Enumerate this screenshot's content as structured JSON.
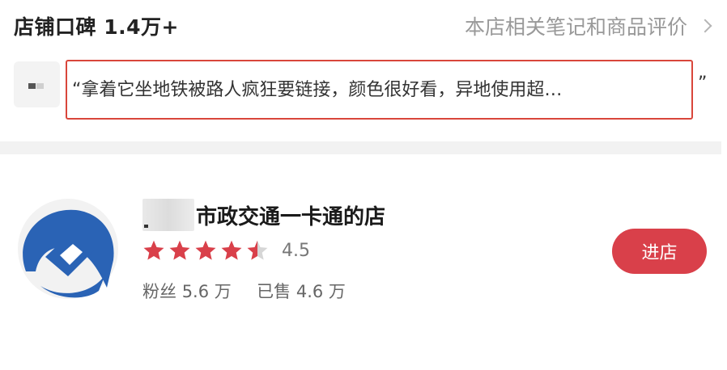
{
  "review": {
    "title": "店铺口碑 1.4万+",
    "link_label": "本店相关笔记和商品评价",
    "quote_open": "“拿着它坐地铁被路人疯狂要链接，颜色很好看，异地使用超…",
    "quote_close": "”"
  },
  "store": {
    "name": "市政交通一卡通的店",
    "rating": "4.5",
    "rating_value": 4.5,
    "rating_max": 5,
    "fans_label": "粉丝",
    "fans_value": "5.6 万",
    "sold_label": "已售",
    "sold_value": "4.6 万",
    "enter_label": "进店"
  },
  "colors": {
    "accent": "#d9404a",
    "star_on": "#d9404a",
    "star_off": "#d6d6d6",
    "logo_blue": "#2a63b5",
    "highlight_border": "#d9463b"
  }
}
